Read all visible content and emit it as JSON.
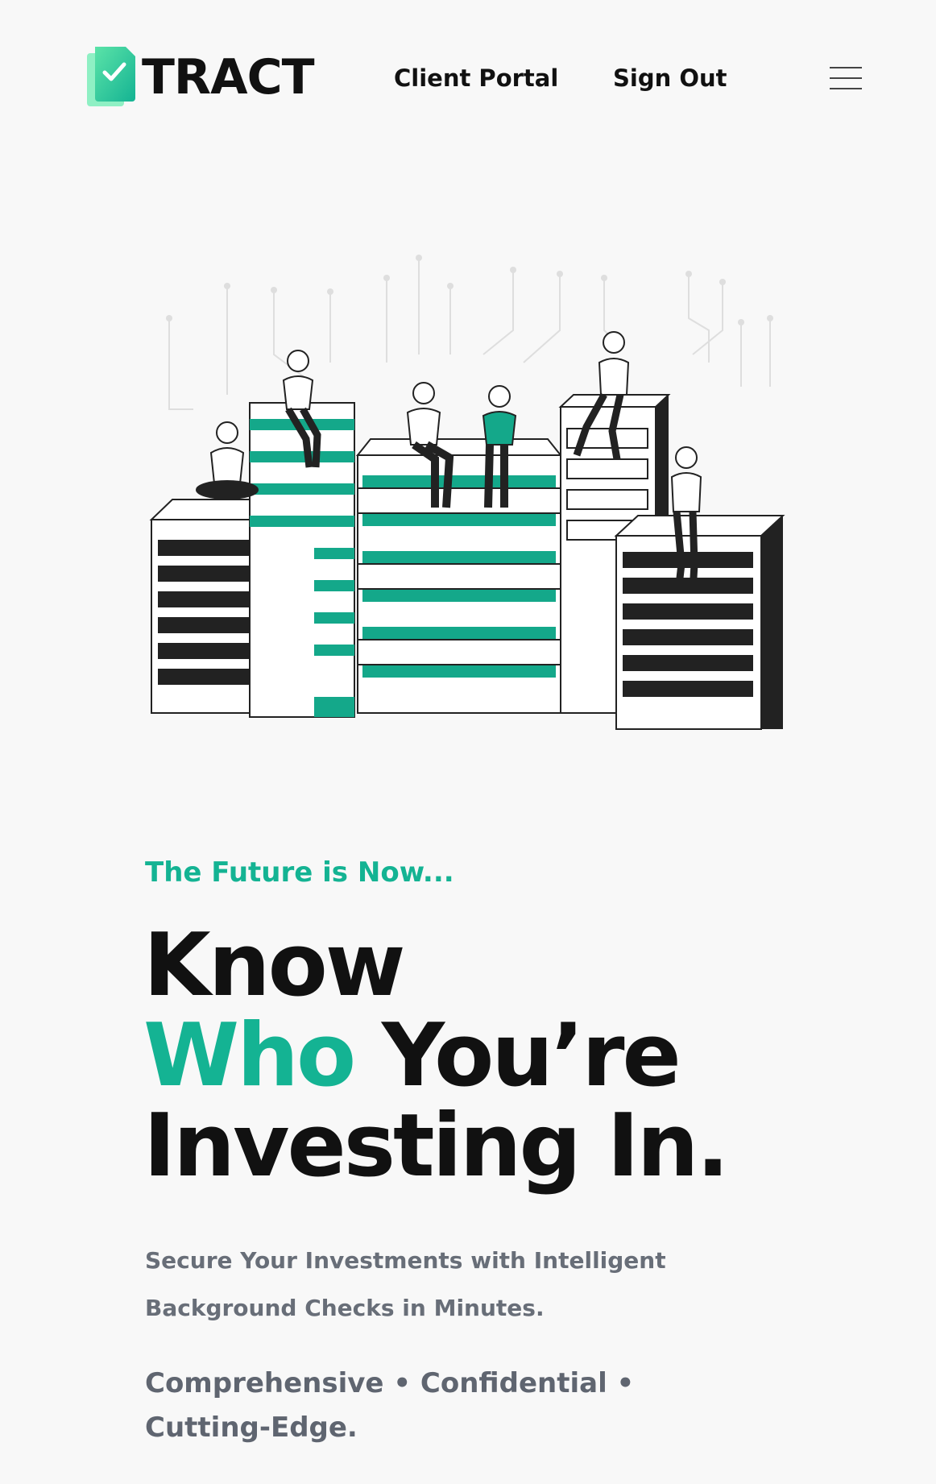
{
  "brand": {
    "name": "TRACT",
    "colors": {
      "accent": "#14b393",
      "dark": "#111111",
      "muted": "#686e78",
      "background": "#f8f8f8"
    }
  },
  "nav": {
    "links": [
      {
        "label": "Client Portal"
      },
      {
        "label": "Sign Out"
      }
    ],
    "menu_icon": "hamburger-menu-icon"
  },
  "hero": {
    "eyebrow": "The Future is Now...",
    "headline": {
      "line1": "Know",
      "accent_word": "Who",
      "line2_rest": " You’re",
      "line3": "Investing In."
    },
    "subtitle_line1": "Secure Your Investments with Intelligent",
    "subtitle_line2": "Background Checks in Minutes.",
    "tagline": "Comprehensive • Confidential • Cutting-Edge."
  }
}
